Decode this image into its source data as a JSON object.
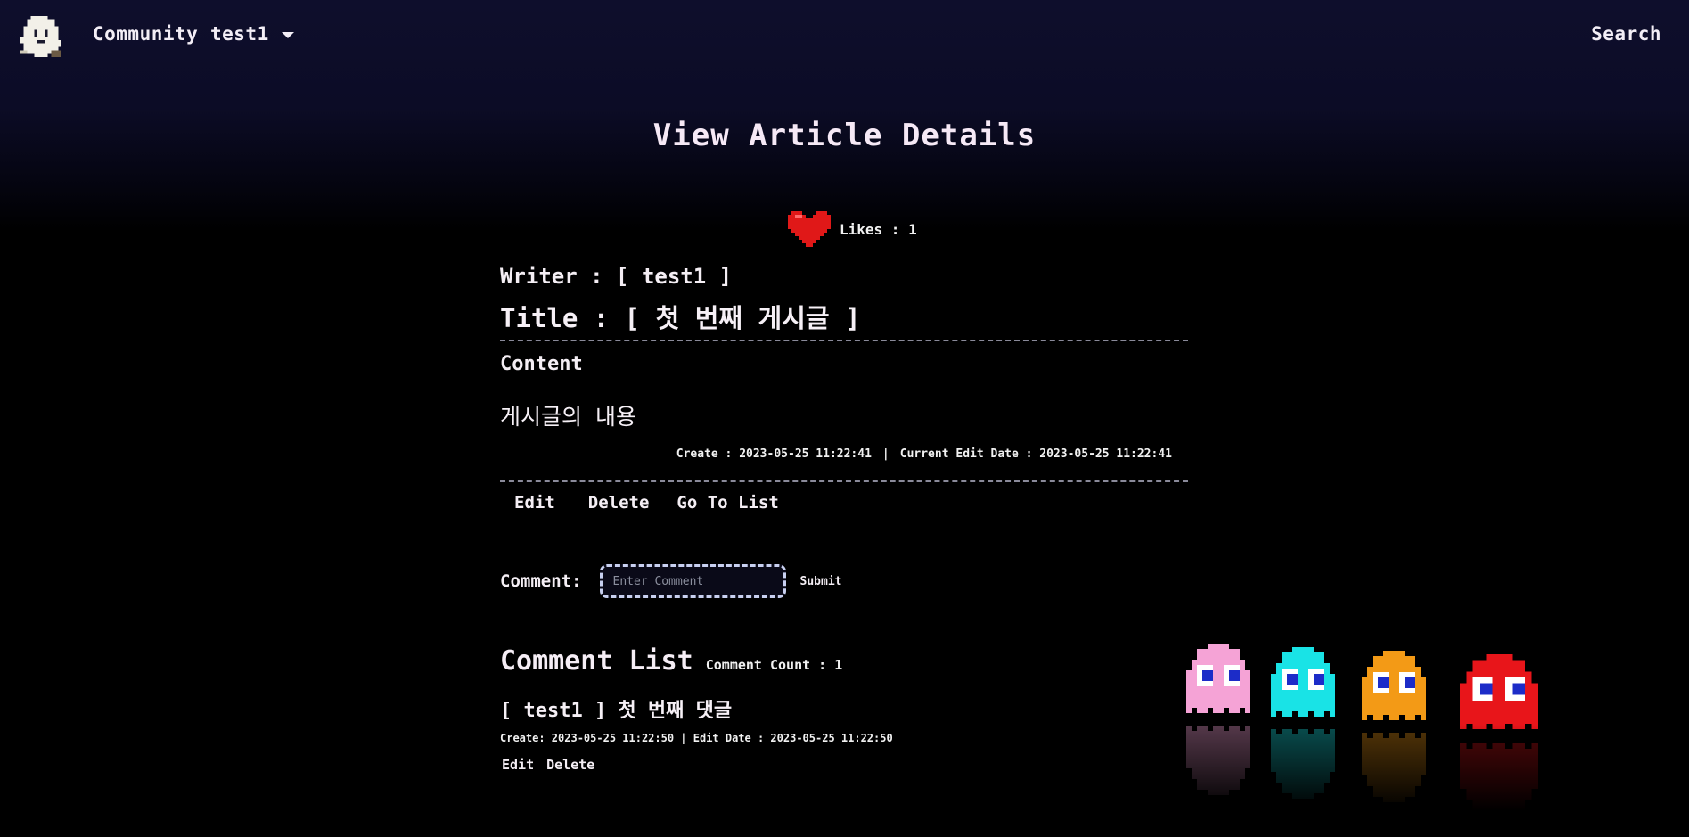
{
  "nav": {
    "community": "Community",
    "user": "test1",
    "search": "Search"
  },
  "page_title": "View Article Details",
  "likes": {
    "label": "Likes : 1"
  },
  "article": {
    "writer": "Writer : [ test1 ]",
    "title": "Title : [ 첫 번째 게시글 ]",
    "content_label": "Content",
    "content_body": "게시글의 내용",
    "created": "Create : 2023-05-25 11:22:41",
    "separator": "|",
    "edited": "Current Edit Date : 2023-05-25 11:22:41",
    "actions": {
      "edit": "Edit",
      "delete": "Delete",
      "list": "Go To List"
    }
  },
  "comment_form": {
    "label": "Comment:",
    "placeholder": "Enter Comment",
    "submit": "Submit"
  },
  "comment_list": {
    "title": "Comment List",
    "count": "Comment Count : 1",
    "items": [
      {
        "text": "[ test1 ] 첫 번째 댓글",
        "dates": "Create: 2023-05-25 11:22:50 | Edit Date : 2023-05-25 11:22:50",
        "edit": "Edit",
        "delete": "Delete"
      }
    ]
  },
  "colors": {
    "heart": "#e01818",
    "ghost_pink": "#f5a3d6",
    "ghost_cyan": "#19e3e6",
    "ghost_orange": "#f39a16",
    "ghost_red": "#e8151a"
  },
  "icons": [
    "ghost-logo-icon",
    "chevron-down-icon",
    "heart-icon",
    "pacman-ghosts-decoration"
  ]
}
